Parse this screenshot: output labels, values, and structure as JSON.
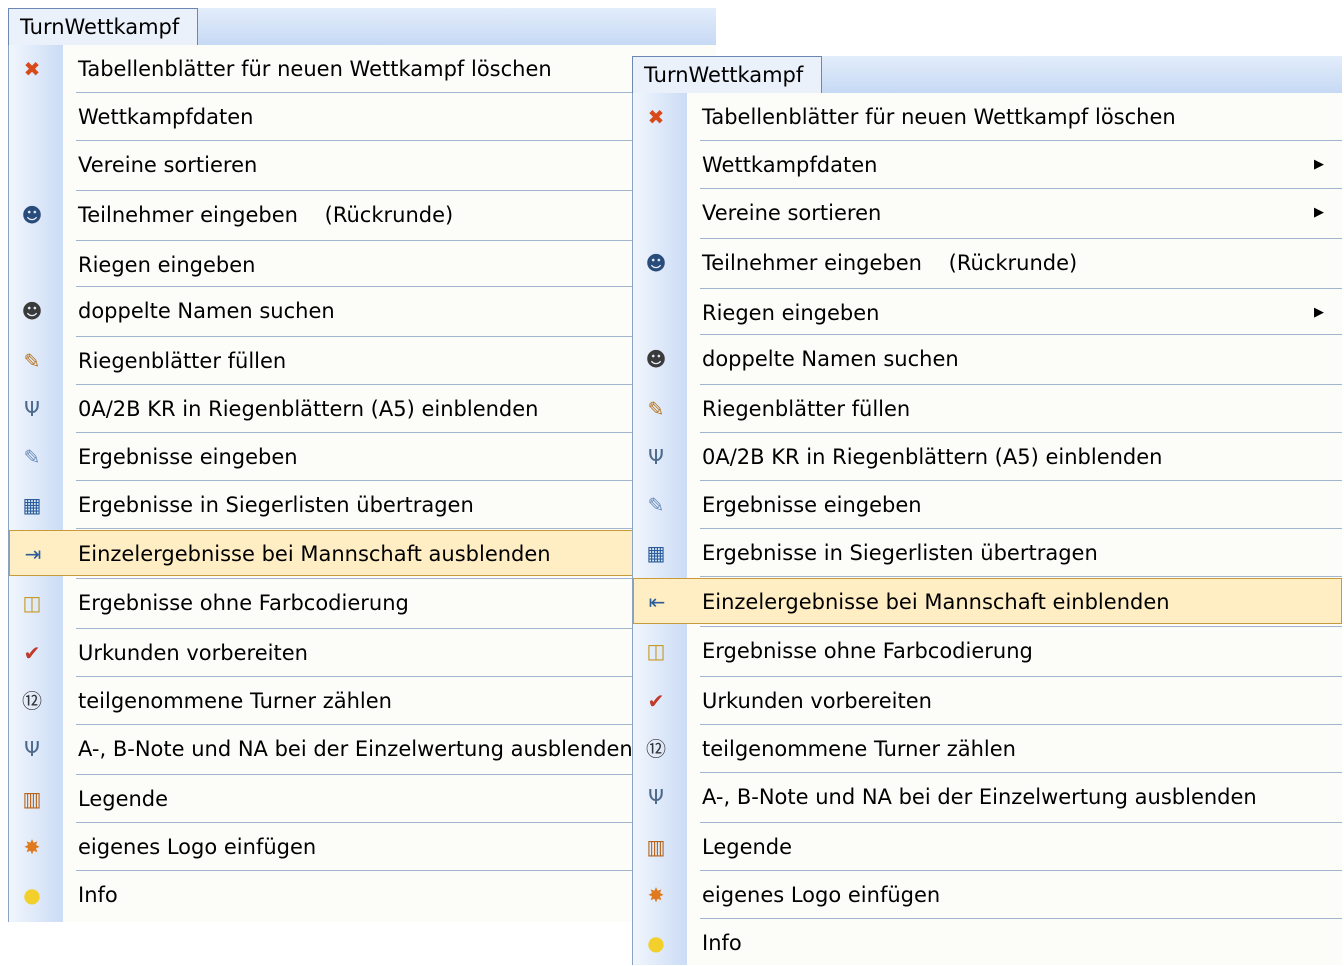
{
  "left_menu": {
    "title": "TurnWettkampf",
    "items": [
      {
        "label": "Tabellenblätter für neuen Wettkampf löschen",
        "icon": "delete-sheets-icon",
        "glyph": "✖",
        "color": "#d84a1b",
        "submenu": false
      },
      {
        "label": "Wettkampfdaten",
        "icon": "",
        "glyph": "",
        "color": "",
        "submenu": false
      },
      {
        "label": "Vereine sortieren",
        "icon": "",
        "glyph": "",
        "color": "",
        "submenu": false
      },
      {
        "label": "Teilnehmer eingeben    (Rückrunde)",
        "icon": "participants-icon",
        "glyph": "☻",
        "color": "#2a4c7a",
        "submenu": false
      },
      {
        "label": "Riegen eingeben",
        "icon": "",
        "glyph": "",
        "color": "",
        "submenu": false
      },
      {
        "label": "doppelte Namen suchen",
        "icon": "duplicate-names-icon",
        "glyph": "☻",
        "color": "#3a3a3a",
        "submenu": false
      },
      {
        "label": "Riegenblätter füllen",
        "icon": "fill-sheets-icon",
        "glyph": "✎",
        "color": "#b7721a",
        "submenu": false
      },
      {
        "label": "0A/2B KR in Riegenblättern (A5) einblenden",
        "icon": "tuning-fork-icon",
        "glyph": "Ψ",
        "color": "#4d6a8c",
        "submenu": false
      },
      {
        "label": "Ergebnisse eingeben",
        "icon": "edit-results-icon",
        "glyph": "✎",
        "color": "#6b8ab8",
        "submenu": false
      },
      {
        "label": "Ergebnisse in Siegerlisten übertragen",
        "icon": "table-icon",
        "glyph": "▦",
        "color": "#2b5d9a",
        "submenu": false
      },
      {
        "label": "Einzelergebnisse bei Mannschaft ausblenden",
        "icon": "arrow-right-icon",
        "glyph": "⇥",
        "color": "#2b5d9a",
        "submenu": false,
        "highlighted": true
      },
      {
        "label": "Ergebnisse ohne Farbcodierung",
        "icon": "no-color-icon",
        "glyph": "◫",
        "color": "#c69a2a",
        "submenu": false
      },
      {
        "label": "Urkunden vorbereiten",
        "icon": "certificate-icon",
        "glyph": "✔",
        "color": "#c0392b",
        "submenu": false
      },
      {
        "label": "teilgenommene Turner zählen",
        "icon": "calendar-icon",
        "glyph": "⑫",
        "color": "#333333",
        "submenu": false
      },
      {
        "label": "A-, B-Note und NA bei der Einzelwertung ausblenden",
        "icon": "tuning-fork-icon",
        "glyph": "Ψ",
        "color": "#4d6a8c",
        "submenu": false
      },
      {
        "label": "Legende",
        "icon": "books-icon",
        "glyph": "▥",
        "color": "#b5651d",
        "submenu": false
      },
      {
        "label": "eigenes Logo einfügen",
        "icon": "fox-logo-icon",
        "glyph": "✸",
        "color": "#e07a1f",
        "submenu": false
      },
      {
        "label": "Info",
        "icon": "lightbulb-icon",
        "glyph": "●",
        "color": "#f2cf2a",
        "submenu": false
      }
    ]
  },
  "right_menu": {
    "title": "TurnWettkampf",
    "items": [
      {
        "label": "Tabellenblätter für neuen Wettkampf löschen",
        "icon": "delete-sheets-icon",
        "glyph": "✖",
        "color": "#d84a1b",
        "submenu": false
      },
      {
        "label": "Wettkampfdaten",
        "icon": "",
        "glyph": "",
        "color": "",
        "submenu": true
      },
      {
        "label": "Vereine sortieren",
        "icon": "",
        "glyph": "",
        "color": "",
        "submenu": true
      },
      {
        "label": "Teilnehmer eingeben    (Rückrunde)",
        "icon": "participants-icon",
        "glyph": "☻",
        "color": "#2a4c7a",
        "submenu": false
      },
      {
        "label": "Riegen eingeben",
        "icon": "",
        "glyph": "",
        "color": "",
        "submenu": true
      },
      {
        "label": "doppelte Namen suchen",
        "icon": "duplicate-names-icon",
        "glyph": "☻",
        "color": "#3a3a3a",
        "submenu": false
      },
      {
        "label": "Riegenblätter füllen",
        "icon": "fill-sheets-icon",
        "glyph": "✎",
        "color": "#b7721a",
        "submenu": false
      },
      {
        "label": "0A/2B KR in Riegenblättern (A5) einblenden",
        "icon": "tuning-fork-icon",
        "glyph": "Ψ",
        "color": "#4d6a8c",
        "submenu": false
      },
      {
        "label": "Ergebnisse eingeben",
        "icon": "edit-results-icon",
        "glyph": "✎",
        "color": "#6b8ab8",
        "submenu": false
      },
      {
        "label": "Ergebnisse in Siegerlisten übertragen",
        "icon": "table-icon",
        "glyph": "▦",
        "color": "#2b5d9a",
        "submenu": false
      },
      {
        "label": "Einzelergebnisse bei Mannschaft einblenden",
        "icon": "arrow-in-icon",
        "glyph": "⇤",
        "color": "#2b5d9a",
        "submenu": false,
        "highlighted": true
      },
      {
        "label": "Ergebnisse ohne Farbcodierung",
        "icon": "no-color-icon",
        "glyph": "◫",
        "color": "#c69a2a",
        "submenu": false
      },
      {
        "label": "Urkunden vorbereiten",
        "icon": "certificate-icon",
        "glyph": "✔",
        "color": "#c0392b",
        "submenu": false
      },
      {
        "label": "teilgenommene Turner zählen",
        "icon": "calendar-icon",
        "glyph": "⑫",
        "color": "#333333",
        "submenu": false
      },
      {
        "label": "A-, B-Note und NA bei der Einzelwertung ausblenden",
        "icon": "tuning-fork-icon",
        "glyph": "Ψ",
        "color": "#4d6a8c",
        "submenu": false
      },
      {
        "label": "Legende",
        "icon": "books-icon",
        "glyph": "▥",
        "color": "#b5651d",
        "submenu": false
      },
      {
        "label": "eigenes Logo einfügen",
        "icon": "fox-logo-icon",
        "glyph": "✸",
        "color": "#e07a1f",
        "submenu": false
      },
      {
        "label": "Info",
        "icon": "lightbulb-icon",
        "glyph": "●",
        "color": "#f2cf2a",
        "submenu": false
      }
    ]
  },
  "submenu_arrow": "▶"
}
